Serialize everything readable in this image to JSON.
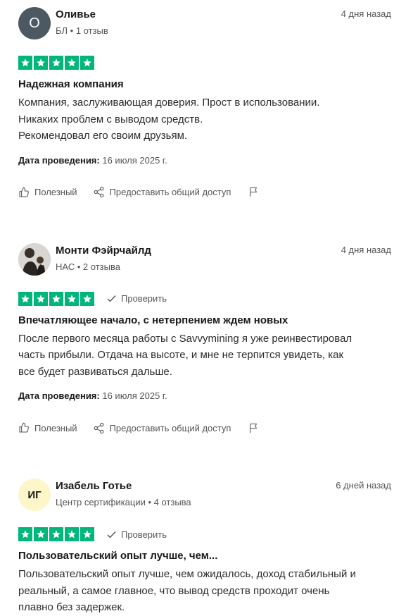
{
  "colors": {
    "star_green": "#00b67a",
    "avatar_gray": "#4c5862",
    "avatar_yellow": "#fdf6c8",
    "muted_text": "#555555"
  },
  "reviews": [
    {
      "avatar_initials": "О",
      "name": "Оливье",
      "meta": "БЛ • 1 отзыв",
      "date": "4 дня назад",
      "rating": 5,
      "verified_label": "",
      "title": "Надежная компания",
      "body_lines": [
        "Компания, заслуживающая доверия. Прост в использовании.",
        "Никаких проблем с выводом средств.",
        "Рекомендовал его своим друзьям."
      ],
      "experience_label": "Дата проведения:",
      "experience_date": "16 июля 2025 г.",
      "helpful_label": "Полезный",
      "share_label": "Предоставить общий доступ"
    },
    {
      "avatar_initials": "",
      "name": "Монти Фэйрчайлд",
      "meta": "НАС • 2 отзыва",
      "date": "4 дня назад",
      "rating": 5,
      "verified_label": "Проверить",
      "title": "Впечатляющее начало, с нетерпением ждем новых",
      "body_lines": [
        "После первого месяца работы с Savvymining я уже реинвестировал",
        "часть прибыли. Отдача на высоте, и мне не терпится увидеть, как",
        "все будет развиваться дальше."
      ],
      "experience_label": "Дата проведения:",
      "experience_date": "16 июля 2025 г.",
      "helpful_label": "Полезный",
      "share_label": "Предоставить общий доступ"
    },
    {
      "avatar_initials": "ИГ",
      "name": "Изабель Готье",
      "meta": "Центр сертификации • 4 отзыва",
      "date": "6 дней назад",
      "rating": 5,
      "verified_label": "Проверить",
      "title": "Пользовательский опыт лучше, чем...",
      "body_lines": [
        "Пользовательский опыт лучше, чем ожидалось, доход стабильный и",
        "реальный, а самое главное, что вывод средств проходит очень",
        "плавно без задержек."
      ]
    }
  ]
}
